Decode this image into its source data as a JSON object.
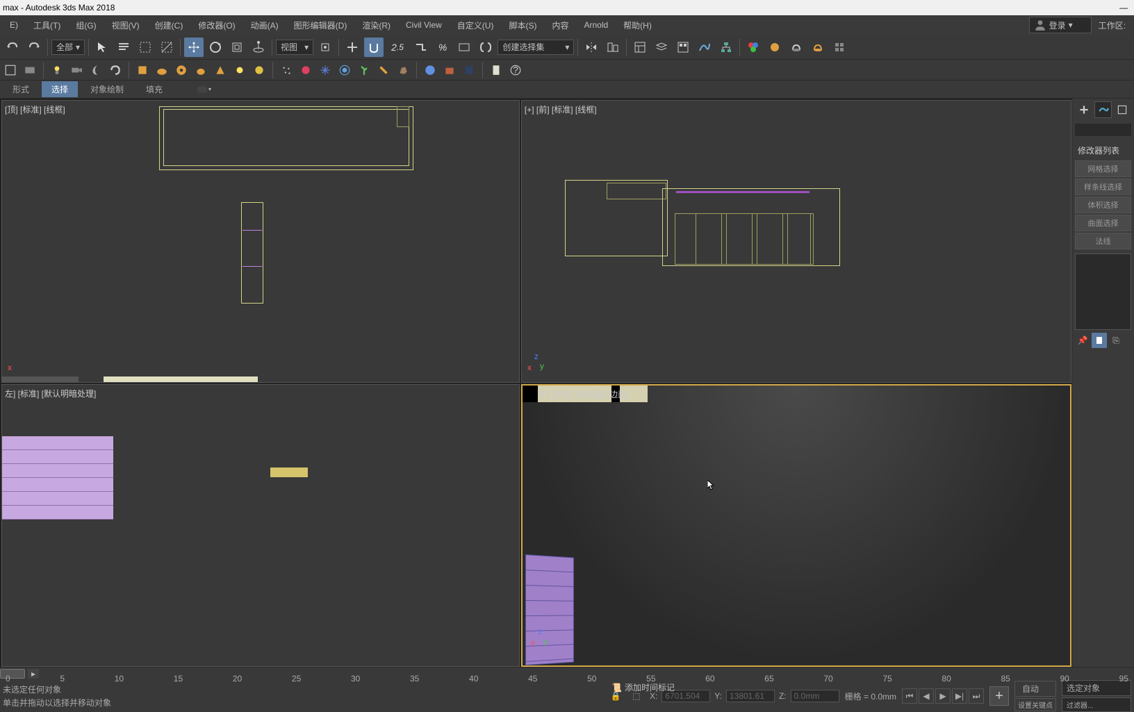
{
  "title": "max - Autodesk 3ds Max 2018",
  "menu": {
    "items": [
      "E)",
      "工具(T)",
      "组(G)",
      "视图(V)",
      "创建(C)",
      "修改器(O)",
      "动画(A)",
      "图形编辑器(D)",
      "渲染(R)",
      "Civil View",
      "自定义(U)",
      "脚本(S)",
      "内容",
      "Arnold",
      "帮助(H)"
    ],
    "login_label": "登录",
    "workspace_label": "工作区:"
  },
  "toolbar1": {
    "all_label": "全部",
    "view_label": "视图",
    "create_set_label": "创建选择集"
  },
  "toolbar3": {
    "tabs": [
      "形式",
      "选择",
      "对象绘制",
      "填充"
    ]
  },
  "viewports": {
    "top": "[顶] [标准] [线框]",
    "front": "[+] [前] [标准] [线框]",
    "left": "左] [标准] [默认明暗处理]",
    "persp": "[P] [透视] [高质量] [边面]"
  },
  "right_panel": {
    "header": "修改器列表",
    "buttons": [
      "网格选择",
      "样条线选择",
      "体积选择",
      "曲面选择",
      "法线"
    ]
  },
  "timeline": {
    "ticks": [
      "0",
      "5",
      "10",
      "15",
      "20",
      "25",
      "30",
      "35",
      "40",
      "45",
      "50",
      "55",
      "60",
      "65",
      "70",
      "75",
      "80",
      "85",
      "90",
      "95"
    ]
  },
  "status": {
    "line1": "未选定任何对象",
    "line2": "单击并拖动以选择并移动对象",
    "x_label": "X:",
    "x_val": "6701.504",
    "y_label": "Y:",
    "y_val": "13801.61",
    "z_label": "Z:",
    "z_val": "0.0mm",
    "grid": "栅格 = 0.0mm",
    "add_time_tag": "添加时间标记",
    "auto": "自动",
    "set_key": "设置关键点",
    "sel_obj": "选定对象",
    "filter": "过滤器..."
  }
}
